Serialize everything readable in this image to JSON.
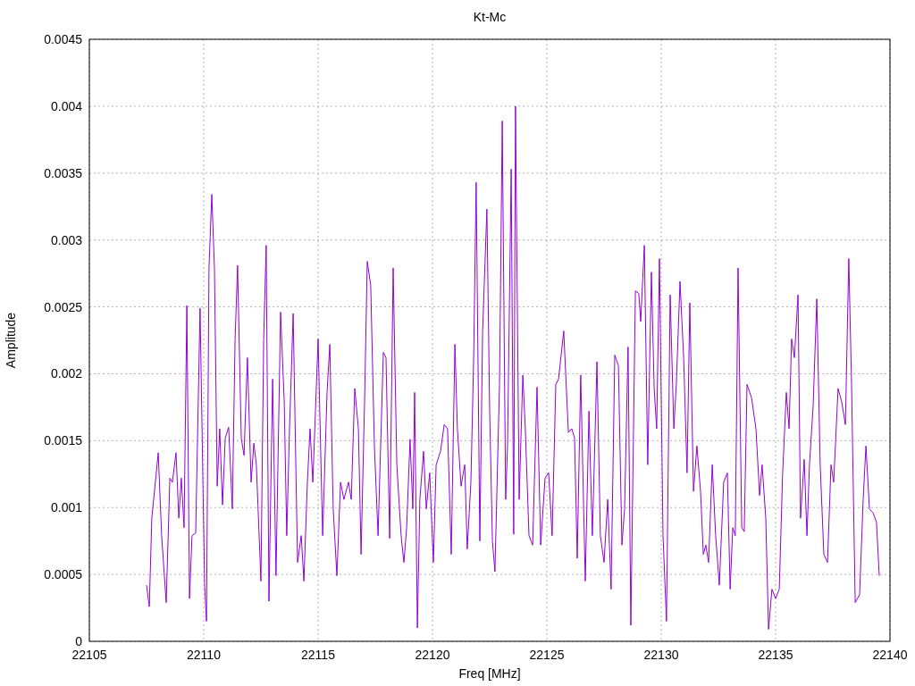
{
  "chart_data": {
    "type": "line",
    "grid": true,
    "title": "Kt-Mc",
    "xlabel": "Freq [MHz]",
    "ylabel": "Amplitude",
    "xlim": [
      22105,
      22140
    ],
    "ylim": [
      0,
      0.0045
    ],
    "xticks": [
      {
        "value": 22105,
        "label": "22105"
      },
      {
        "value": 22110,
        "label": "22110"
      },
      {
        "value": 22115,
        "label": "22115"
      },
      {
        "value": 22120,
        "label": "22120"
      },
      {
        "value": 22125,
        "label": "22125"
      },
      {
        "value": 22130,
        "label": "22130"
      },
      {
        "value": 22135,
        "label": "22135"
      },
      {
        "value": 22140,
        "label": "22140"
      }
    ],
    "yticks": [
      {
        "value": 0,
        "label": "0"
      },
      {
        "value": 0.0005,
        "label": "0.0005"
      },
      {
        "value": 0.001,
        "label": "0.001"
      },
      {
        "value": 0.0015,
        "label": "0.0015"
      },
      {
        "value": 0.002,
        "label": "0.002"
      },
      {
        "value": 0.0025,
        "label": "0.0025"
      },
      {
        "value": 0.003,
        "label": "0.003"
      },
      {
        "value": 0.0035,
        "label": "0.0035"
      },
      {
        "value": 0.004,
        "label": "0.004"
      },
      {
        "value": 0.0045,
        "label": "0.0045"
      }
    ],
    "x": [
      22107.5,
      22107.62,
      22107.73,
      22108.01,
      22108.16,
      22108.36,
      22108.52,
      22108.63,
      22108.79,
      22108.91,
      22109.02,
      22109.14,
      22109.26,
      22109.38,
      22109.49,
      22109.65,
      22109.84,
      22110.04,
      22110.12,
      22110.23,
      22110.35,
      22110.47,
      22110.59,
      22110.7,
      22110.82,
      22110.94,
      22111.09,
      22111.25,
      22111.37,
      22111.48,
      22111.64,
      22111.76,
      22111.91,
      22112.07,
      22112.19,
      22112.3,
      22112.5,
      22112.62,
      22112.73,
      22112.85,
      22113.01,
      22113.16,
      22113.36,
      22113.52,
      22113.63,
      22113.75,
      22113.91,
      22114.1,
      22114.26,
      22114.38,
      22114.53,
      22114.65,
      22114.77,
      22115.0,
      22115.2,
      22115.39,
      22115.51,
      22115.66,
      22115.82,
      22115.98,
      22116.13,
      22116.33,
      22116.45,
      22116.6,
      22116.76,
      22116.88,
      22117.03,
      22117.15,
      22117.3,
      22117.46,
      22117.62,
      22117.85,
      22117.97,
      22118.13,
      22118.28,
      22118.44,
      22118.63,
      22118.75,
      22118.87,
      22119.02,
      22119.14,
      22119.22,
      22119.34,
      22119.45,
      22119.61,
      22119.73,
      22119.88,
      22120.04,
      22120.16,
      22120.35,
      22120.51,
      22120.66,
      22120.82,
      22120.98,
      22121.09,
      22121.25,
      22121.41,
      22121.52,
      22121.68,
      22121.8,
      22121.91,
      22122.07,
      22122.19,
      22122.38,
      22122.5,
      22122.62,
      22122.73,
      22122.93,
      22123.05,
      22123.2,
      22123.28,
      22123.44,
      22123.55,
      22123.63,
      22123.79,
      22123.95,
      22124.06,
      22124.22,
      22124.38,
      22124.57,
      22124.73,
      22124.92,
      22125.08,
      22125.23,
      22125.39,
      22125.51,
      22125.74,
      22125.94,
      22126.09,
      22126.21,
      22126.33,
      22126.48,
      22126.68,
      22126.84,
      22126.99,
      22127.19,
      22127.34,
      22127.5,
      22127.66,
      22127.81,
      22127.97,
      22128.13,
      22128.28,
      22128.4,
      22128.55,
      22128.67,
      22128.87,
      22129.02,
      22129.1,
      22129.26,
      22129.41,
      22129.57,
      22129.69,
      22129.8,
      22129.92,
      22130.08,
      22130.23,
      22130.39,
      22130.55,
      22130.66,
      22130.82,
      22130.98,
      22131.13,
      22131.25,
      22131.41,
      22131.56,
      22131.72,
      22131.84,
      22131.95,
      22132.07,
      22132.23,
      22132.38,
      22132.54,
      22132.73,
      22132.89,
      22133.01,
      22133.13,
      22133.24,
      22133.36,
      22133.52,
      22133.63,
      22133.75,
      22133.95,
      22134.14,
      22134.3,
      22134.41,
      22134.57,
      22134.69,
      22134.84,
      22135.0,
      22135.16,
      22135.31,
      22135.47,
      22135.59,
      22135.7,
      22135.82,
      22135.98,
      22136.09,
      22136.25,
      22136.37,
      22136.48,
      22136.64,
      22136.8,
      22136.95,
      22137.11,
      22137.27,
      22137.42,
      22137.54,
      22137.73,
      22137.89,
      22138.05,
      22138.2,
      22138.32,
      22138.48,
      22138.67,
      22138.83,
      22138.95,
      22139.1,
      22139.26,
      22139.41,
      22139.53
    ],
    "series": [
      {
        "color": "#9400d3",
        "values": [
          0.00042,
          0.00026,
          0.00092,
          0.00141,
          0.00079,
          0.00029,
          0.00122,
          0.00119,
          0.00141,
          0.00092,
          0.00122,
          0.00085,
          0.00251,
          0.00032,
          0.00079,
          0.00081,
          0.00249,
          0.00042,
          0.00015,
          0.00279,
          0.00334,
          0.00279,
          0.00116,
          0.00159,
          0.00102,
          0.00152,
          0.0016,
          0.00099,
          0.00226,
          0.00281,
          0.00152,
          0.00139,
          0.00212,
          0.00119,
          0.00148,
          0.00132,
          0.00045,
          0.00226,
          0.00296,
          0.0003,
          0.00196,
          0.00049,
          0.00246,
          0.00179,
          0.00079,
          0.00159,
          0.00245,
          0.00059,
          0.00079,
          0.00045,
          0.00119,
          0.00159,
          0.00119,
          0.00226,
          0.00079,
          0.00186,
          0.00222,
          0.00099,
          0.00049,
          0.00119,
          0.00106,
          0.00119,
          0.00106,
          0.00189,
          0.00159,
          0.00065,
          0.00179,
          0.00284,
          0.00266,
          0.00146,
          0.00079,
          0.00216,
          0.00212,
          0.00077,
          0.00279,
          0.00132,
          0.00079,
          0.00059,
          0.00085,
          0.00151,
          0.00099,
          0.00186,
          0.0001,
          0.00106,
          0.00142,
          0.00099,
          0.00126,
          0.00059,
          0.00132,
          0.00142,
          0.00162,
          0.00159,
          0.00065,
          0.00222,
          0.00159,
          0.00116,
          0.00132,
          0.00069,
          0.00119,
          0.00212,
          0.00343,
          0.00075,
          0.00232,
          0.00323,
          0.00172,
          0.00075,
          0.00052,
          0.00192,
          0.00389,
          0.00106,
          0.00146,
          0.00353,
          0.0008,
          0.004,
          0.00106,
          0.00199,
          0.00159,
          0.00079,
          0.00072,
          0.0019,
          0.00072,
          0.00122,
          0.00126,
          0.00079,
          0.00192,
          0.00196,
          0.00232,
          0.00156,
          0.00159,
          0.00152,
          0.00062,
          0.00199,
          0.00045,
          0.00172,
          0.00079,
          0.00209,
          0.00079,
          0.00059,
          0.00106,
          0.00039,
          0.00214,
          0.00206,
          0.00072,
          0.00099,
          0.0022,
          0.00012,
          0.00262,
          0.0026,
          0.00239,
          0.00296,
          0.00132,
          0.00276,
          0.00189,
          0.00159,
          0.00286,
          0.00079,
          0.00015,
          0.00259,
          0.00159,
          0.00192,
          0.00269,
          0.00212,
          0.00126,
          0.00253,
          0.00112,
          0.00146,
          0.00112,
          0.00065,
          0.00072,
          0.00059,
          0.00132,
          0.00079,
          0.00042,
          0.00119,
          0.00126,
          0.00039,
          0.00085,
          0.00079,
          0.00279,
          0.00085,
          0.00082,
          0.00192,
          0.00182,
          0.00159,
          0.00109,
          0.00132,
          0.00092,
          9e-05,
          0.00039,
          0.00032,
          0.00039,
          0.00126,
          0.00186,
          0.00159,
          0.00226,
          0.00212,
          0.00259,
          0.00092,
          0.00136,
          0.00079,
          0.00132,
          0.00176,
          0.00256,
          0.00132,
          0.00065,
          0.00059,
          0.00132,
          0.00119,
          0.00189,
          0.00179,
          0.00162,
          0.00286,
          0.00192,
          0.00029,
          0.00035,
          0.00106,
          0.00146,
          0.00099,
          0.00096,
          0.00089,
          0.00049
        ]
      }
    ]
  }
}
